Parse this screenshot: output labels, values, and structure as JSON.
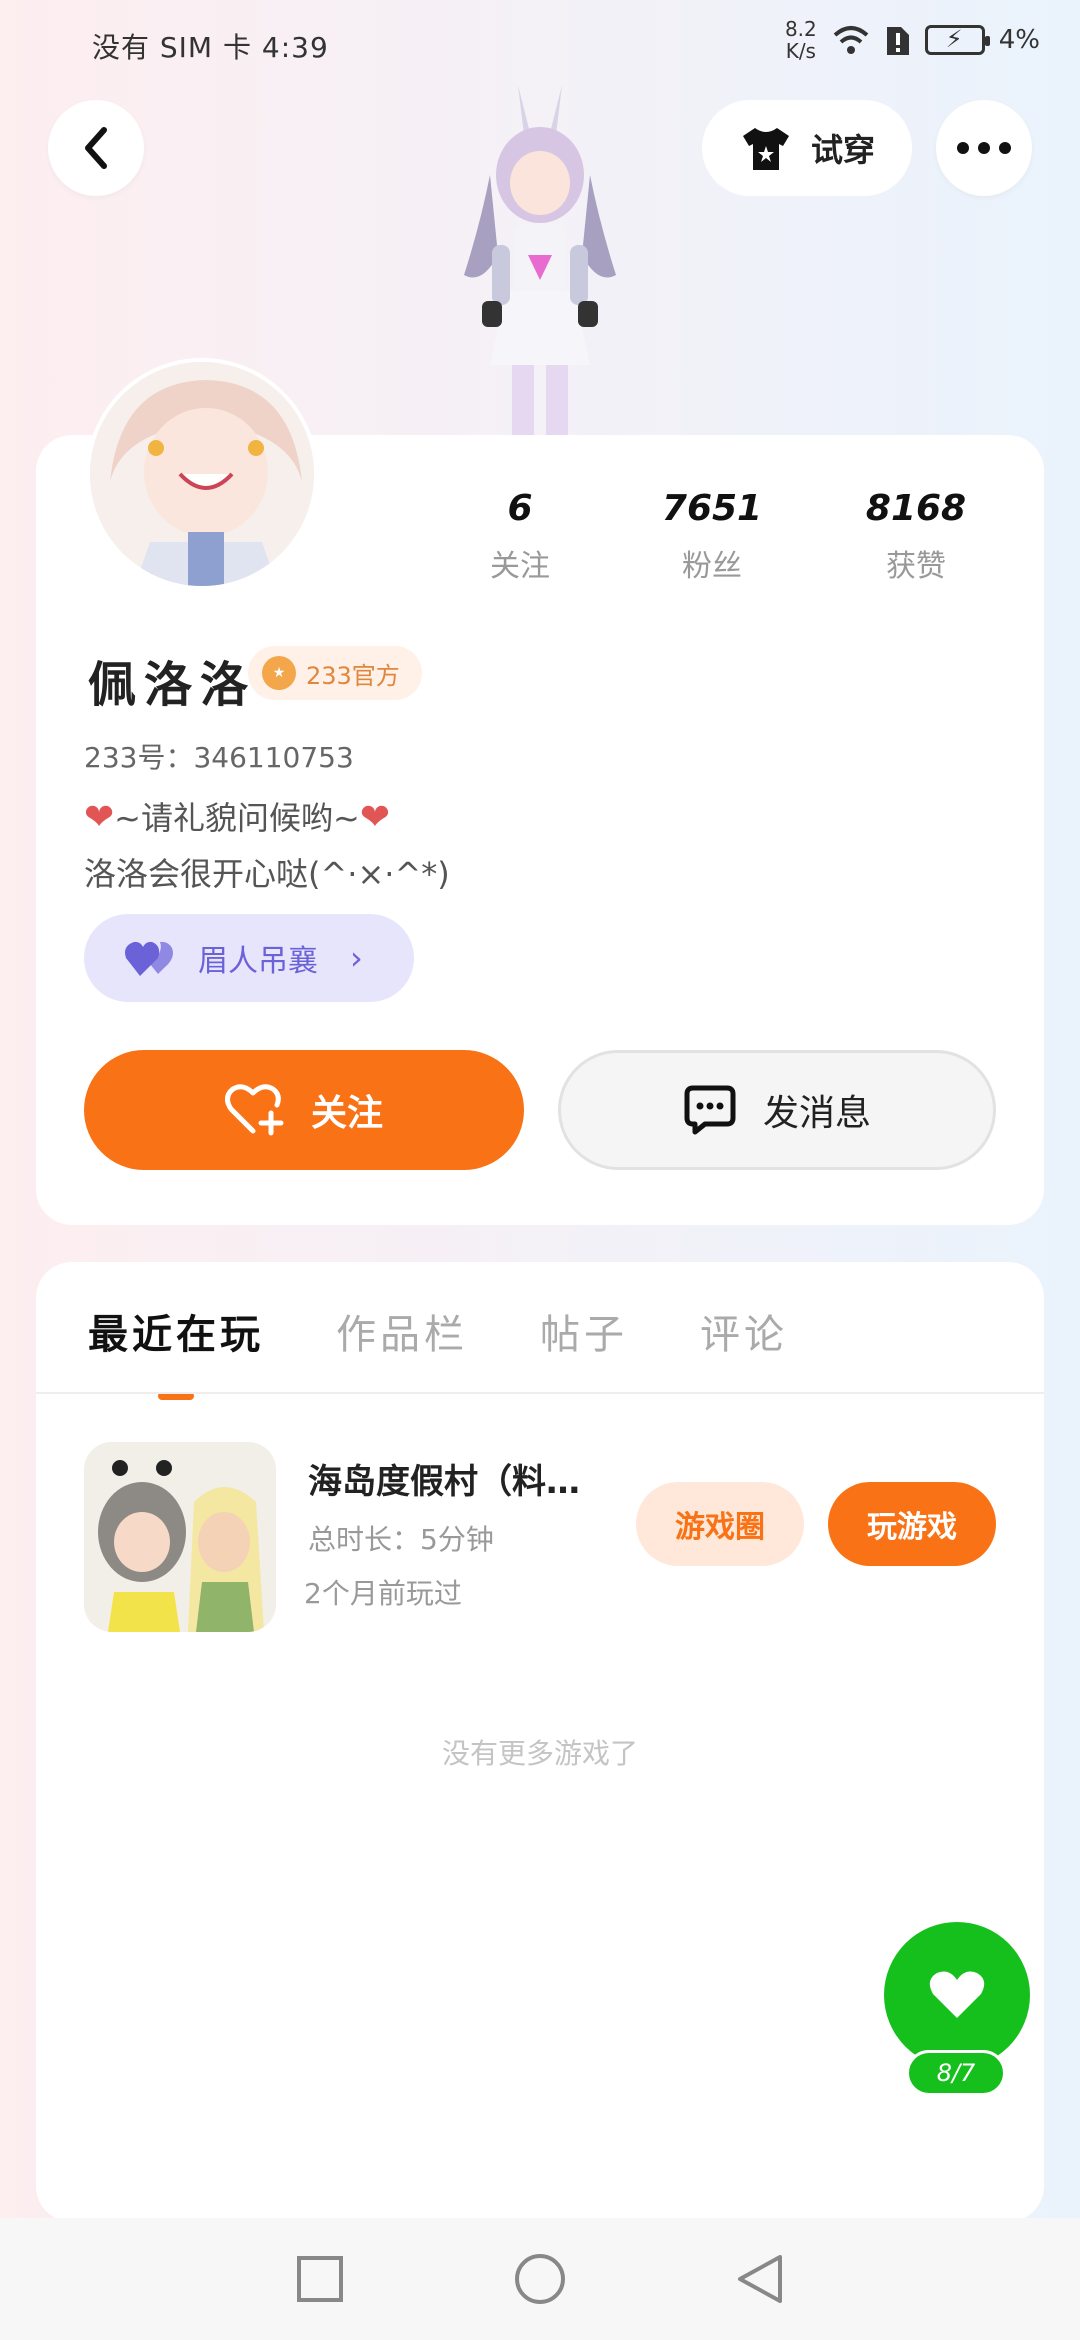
{
  "status_bar": {
    "carrier": "没有 SIM 卡",
    "time": "4:39",
    "net_speed_value": "8.2",
    "net_speed_unit": "K/s",
    "battery": "4%"
  },
  "header": {
    "tryon_label": "试穿"
  },
  "profile": {
    "stats": [
      {
        "value": "6",
        "label": "关注"
      },
      {
        "value": "7651",
        "label": "粉丝"
      },
      {
        "value": "8168",
        "label": "获赞"
      }
    ],
    "nickname": "佩洛洛",
    "badge_label": "233官方",
    "uid": "233号：346110753",
    "bio_line1": "~请礼貌问候哟~",
    "bio_line2": "洛洛会很开心哒(^·×·^*)",
    "companion_label": "眉人吊襄",
    "follow_label": "关注",
    "message_label": "发消息"
  },
  "tabs": [
    {
      "label": "最近在玩",
      "active": true
    },
    {
      "label": "作品栏",
      "active": false
    },
    {
      "label": "帖子",
      "active": false
    },
    {
      "label": "评论",
      "active": false
    }
  ],
  "game": {
    "title": "海岛度假村（料…",
    "total_time": "总时长：5分钟",
    "last_played": "2个月前玩过",
    "circle_label": "游戏圈",
    "play_label": "玩游戏"
  },
  "no_more_text": "没有更多游戏了",
  "like_fab": {
    "count": "8/7"
  },
  "colors": {
    "accent": "#f97316",
    "like_green": "#16c01c",
    "companion_purple": "#6b62d8"
  }
}
